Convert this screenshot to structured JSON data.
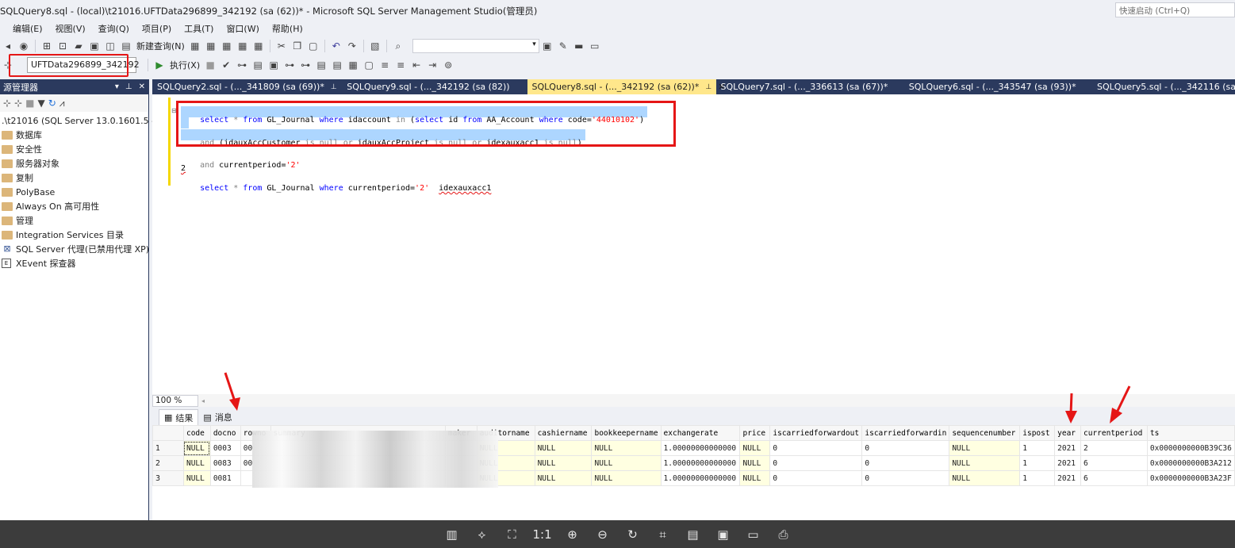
{
  "window": {
    "title": "SQLQuery8.sql - (local)\\t21016.UFTData296899_342192 (sa (62))* - Microsoft SQL Server Management Studio(管理员)",
    "quick_launch_placeholder": "快速启动 (Ctrl+Q)"
  },
  "menu": [
    "编辑(E)",
    "视图(V)",
    "查询(Q)",
    "项目(P)",
    "工具(T)",
    "窗口(W)",
    "帮助(H)"
  ],
  "toolbar1": {
    "new_query_label": "新建查询(N)"
  },
  "toolbar2": {
    "database": "UFTData296899_342192",
    "execute_label": "执行(X)"
  },
  "object_explorer": {
    "title": "源管理器",
    "server": ".\\t21016 (SQL Server 13.0.1601.5 - sa)",
    "nodes": [
      "数据库",
      "安全性",
      "服务器对象",
      "复制",
      "PolyBase",
      "Always On 高可用性",
      "管理",
      "Integration Services 目录",
      "SQL Server 代理(已禁用代理 XP)",
      "XEvent 探查器"
    ]
  },
  "tabs": [
    {
      "label": "SQLQuery2.sql - (..._341809 (sa (69))*"
    },
    {
      "label": "SQLQuery9.sql - (..._342192 (sa (82))"
    },
    {
      "label": "SQLQuery8.sql - (..._342192 (sa (62))*",
      "active": true
    },
    {
      "label": "SQLQuery7.sql - (..._336613 (sa (67))*"
    },
    {
      "label": "SQLQuery6.sql - (..._343547 (sa (93))*"
    },
    {
      "label": "SQLQuery5.sql - (..._342116 (sa"
    }
  ],
  "editor": {
    "line1": {
      "kw_select": "select",
      "star": " * ",
      "kw_from": "from",
      "t1": " GL_Journal ",
      "kw_where": "where",
      "t2": " idaccount ",
      "kw_in": "in",
      "t3": " (",
      "kw_select2": "select",
      "t4": " id ",
      "kw_from2": "from",
      "t5": " AA_Account ",
      "kw_where2": "where",
      "t6": " code=",
      "str": "'44010102'",
      "t7": ")"
    },
    "line3": {
      "kw_and": "and",
      "t1": " (idauxAccCustomer ",
      "kw_is1": "is null",
      "kw_or1": " or",
      "t2": " idauxAccProject ",
      "kw_is2": "is null",
      "kw_or2": " or",
      "t3": " idexauxacc1 ",
      "kw_is3": "is null",
      "t4": ")"
    },
    "line5": {
      "kw_and": "and",
      "t1": " currentperiod=",
      "str": "'2'"
    },
    "line6": "2",
    "line7": {
      "kw_select": "select",
      "star": " * ",
      "kw_from": "from",
      "t1": " GL_Journal ",
      "kw_where": "where",
      "t2": " currentperiod=",
      "str": "'2'",
      "t3": "  ",
      "t4": "idexauxacc1"
    }
  },
  "zoom": "100 %",
  "result_tabs": {
    "results": "结果",
    "messages": "消息"
  },
  "grid": {
    "columns": [
      "code",
      "docno",
      "rowno",
      "summary",
      "maker",
      "auditorname",
      "cashiername",
      "bookkeepername",
      "exchangerate",
      "price",
      "iscarriedforwardout",
      "iscarriedforwardin",
      "sequencenumber",
      "ispost",
      "year",
      "currentperiod",
      "ts"
    ],
    "rows": [
      [
        "1",
        "NULL",
        "0003",
        "00",
        "",
        "",
        "NULL",
        "NULL",
        "NULL",
        "1.00000000000000",
        "NULL",
        "0",
        "0",
        "NULL",
        "1",
        "2021",
        "2",
        "0x0000000000B39C36"
      ],
      [
        "2",
        "NULL",
        "0083",
        "00",
        "",
        "",
        "NULL",
        "NULL",
        "NULL",
        "1.00000000000000",
        "NULL",
        "0",
        "0",
        "NULL",
        "1",
        "2021",
        "6",
        "0x0000000000B3A212"
      ],
      [
        "3",
        "NULL",
        "0081",
        "",
        "",
        "",
        "NULL",
        "NULL",
        "NULL",
        "1.00000000000000",
        "NULL",
        "0",
        "0",
        "NULL",
        "1",
        "2021",
        "6",
        "0x0000000000B3A23F"
      ]
    ]
  },
  "viewer_toolbar": {
    "one_to_one": "1:1"
  },
  "colors": {
    "accent_red": "#e51616",
    "tab_active": "#ffe78b",
    "tab_bar": "#2b3a5e",
    "selection": "#add6ff"
  }
}
